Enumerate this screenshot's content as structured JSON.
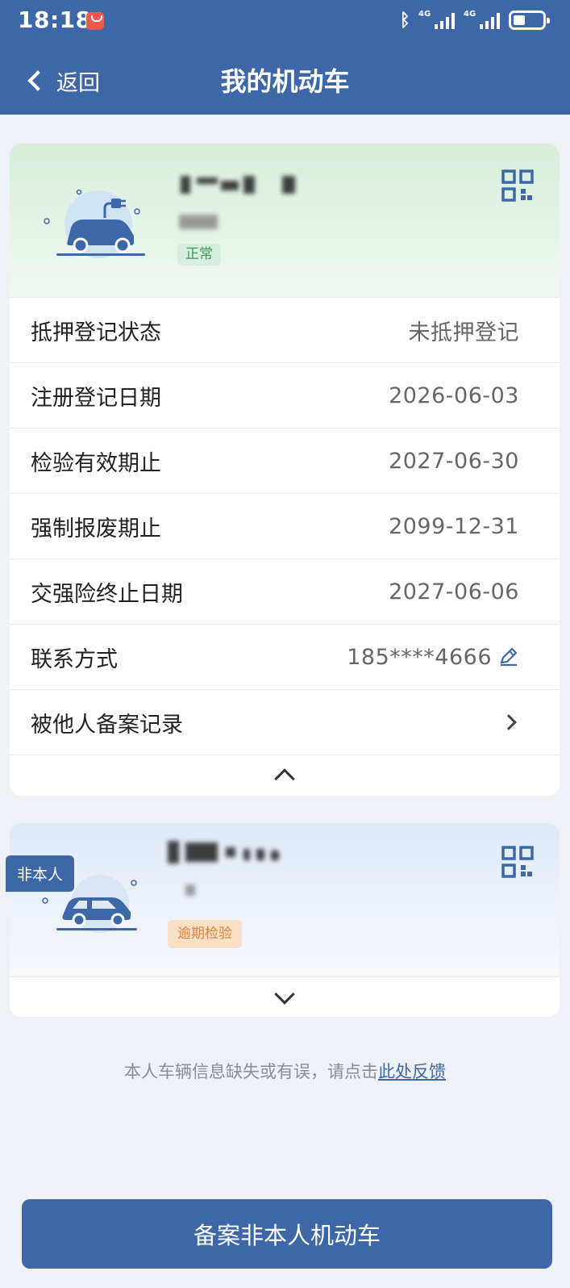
{
  "status_bar": {
    "time": "18:18",
    "network_1": "4G",
    "network_2": "4G"
  },
  "nav": {
    "back_label": "返回",
    "title": "我的机动车"
  },
  "vehicle_primary": {
    "status_badge": "正常",
    "rows": [
      {
        "label": "抵押登记状态",
        "value": "未抵押登记"
      },
      {
        "label": "注册登记日期",
        "value": "2026-06-03"
      },
      {
        "label": "检验有效期止",
        "value": "2027-06-30"
      },
      {
        "label": "强制报废期止",
        "value": "2099-12-31"
      },
      {
        "label": "交强险终止日期",
        "value": "2027-06-06"
      },
      {
        "label": "联系方式",
        "value": "185****4666"
      },
      {
        "label": "被他人备案记录",
        "value": ""
      }
    ]
  },
  "vehicle_secondary": {
    "owner_tag": "非本人",
    "status_badge": "逾期检验"
  },
  "feedback": {
    "text": "本人车辆信息缺失或有误，请点击",
    "link": "此处反馈"
  },
  "primary_button": {
    "label": "备案非本人机动车"
  },
  "colors": {
    "brand": "#3e67a8",
    "ok_green": "#3a9a5c",
    "warn_orange": "#e0823c"
  }
}
